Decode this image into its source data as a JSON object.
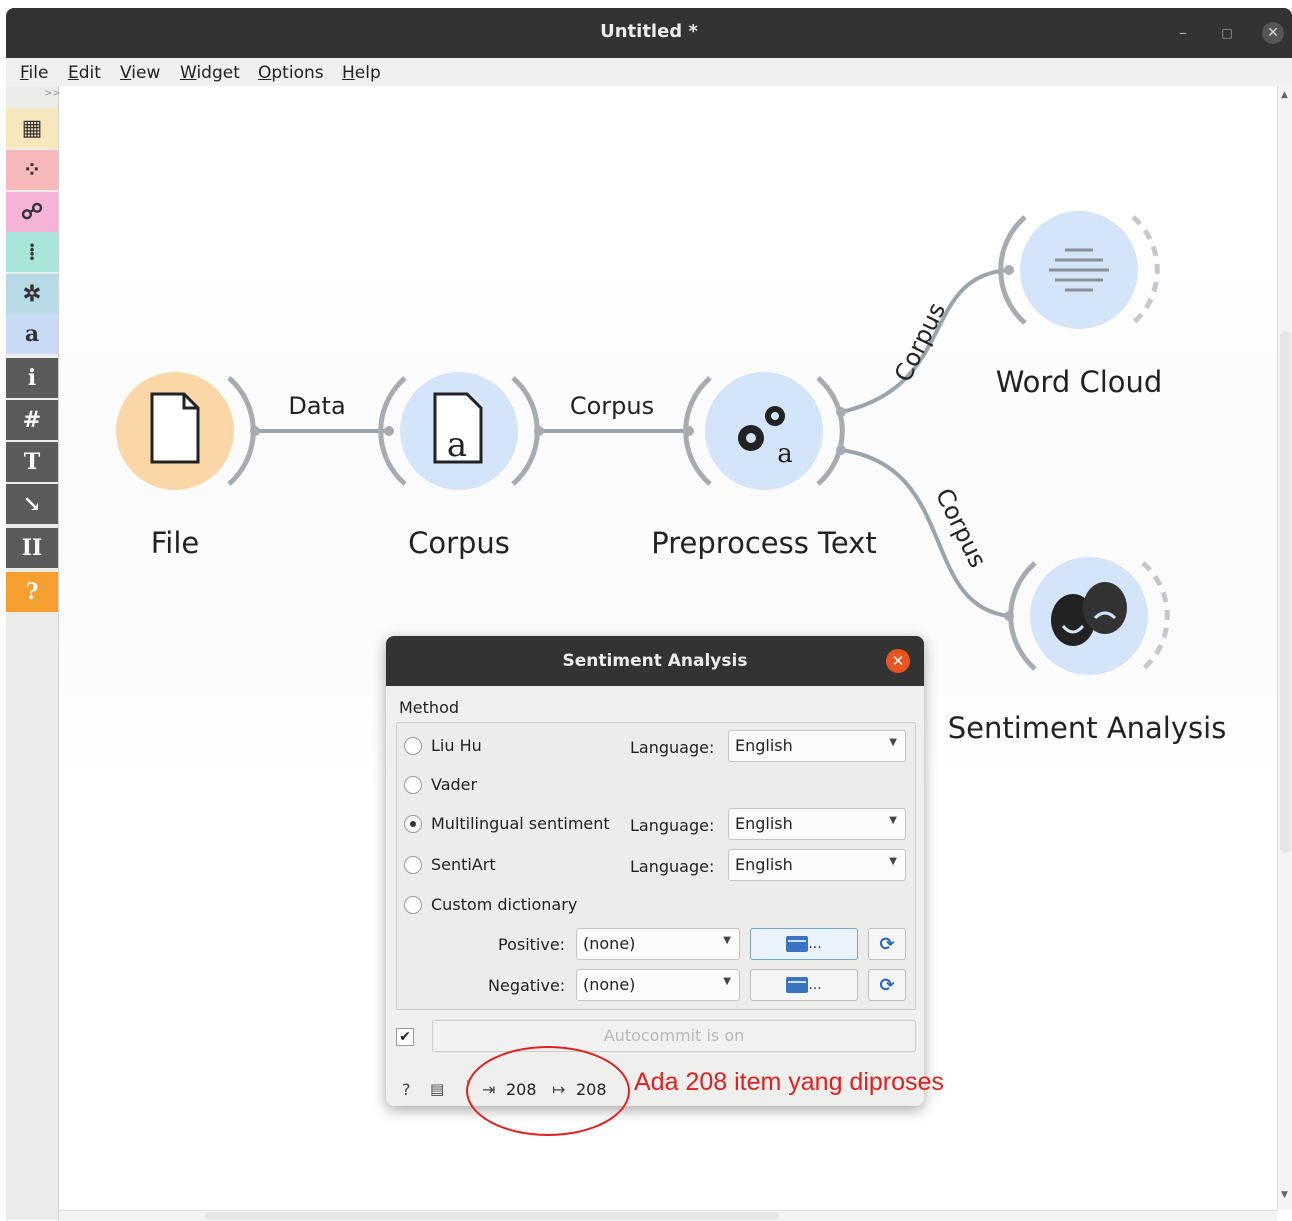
{
  "window": {
    "title": "Untitled *",
    "controls": {
      "minimize": "–",
      "maximize": "□",
      "close": "✕"
    }
  },
  "menu": [
    "File",
    "Edit",
    "View",
    "Widget",
    "Options",
    "Help"
  ],
  "toolbar": {
    "expander": ">>",
    "items": [
      {
        "name": "data-category",
        "icon": "table-icon",
        "glyph": "▦",
        "bg": "#f7e7bd"
      },
      {
        "name": "visualize-category",
        "icon": "scatter-icon",
        "glyph": "⁘",
        "bg": "#f7b9b9"
      },
      {
        "name": "model-category",
        "icon": "tree-icon",
        "glyph": "☍",
        "bg": "#f6b3d8"
      },
      {
        "name": "evaluate-category",
        "icon": "grid-icon",
        "glyph": "⁞",
        "bg": "#a8e6dc"
      },
      {
        "name": "unsupervised-category",
        "icon": "cluster-icon",
        "glyph": "✲",
        "bg": "#b8d9e6"
      },
      {
        "name": "text-mining-category",
        "icon": "text-a-icon",
        "glyph": "a",
        "bg": "#c9daf6"
      },
      {
        "name": "info-button",
        "icon": "info-icon",
        "glyph": "i",
        "bg": "#5a5a5a"
      },
      {
        "name": "grid-button",
        "icon": "hash-icon",
        "glyph": "#",
        "bg": "#5a5a5a"
      },
      {
        "name": "text-annotation-button",
        "icon": "text-t-icon",
        "glyph": "T",
        "bg": "#5a5a5a"
      },
      {
        "name": "arrow-annotation-button",
        "icon": "arrow-icon",
        "glyph": "↘",
        "bg": "#5a5a5a"
      },
      {
        "name": "pause-button",
        "icon": "pause-icon",
        "glyph": "II",
        "bg": "#5a5a5a"
      },
      {
        "name": "help-button",
        "icon": "help-icon",
        "glyph": "?",
        "bg": "#f5a030"
      }
    ]
  },
  "workflow": {
    "nodes": [
      {
        "name": "file",
        "label": "File",
        "icon": "file-icon",
        "color": "#fbd7a8",
        "ring": "#f7c58c"
      },
      {
        "name": "corpus",
        "label": "Corpus",
        "icon": "corpus-icon",
        "color": "#d4e4f9",
        "ring": "#bfd6f5"
      },
      {
        "name": "preprocess-text",
        "label": "Preprocess Text",
        "icon": "gears-icon",
        "color": "#d4e4f9",
        "ring": "#bfd6f5"
      },
      {
        "name": "word-cloud",
        "label": "Word Cloud",
        "icon": "word-cloud-icon",
        "color": "#d4e4f9",
        "ring": "#bfd6f5"
      },
      {
        "name": "sentiment-analysis",
        "label": "Sentiment Analysis",
        "icon": "masks-icon",
        "color": "#d4e4f9",
        "ring": "#bfd6f5"
      }
    ],
    "links": [
      {
        "from": "file",
        "to": "corpus",
        "label": "Data"
      },
      {
        "from": "corpus",
        "to": "preprocess-text",
        "label": "Corpus"
      },
      {
        "from": "preprocess-text",
        "to": "word-cloud",
        "label": "Corpus"
      },
      {
        "from": "preprocess-text",
        "to": "sentiment-analysis",
        "label": "Corpus"
      }
    ]
  },
  "dialog": {
    "title": "Sentiment Analysis",
    "method_group_label": "Method",
    "methods": [
      {
        "label": "Liu Hu",
        "selected": false,
        "has_language": true,
        "language": "English"
      },
      {
        "label": "Vader",
        "selected": false,
        "has_language": false
      },
      {
        "label": "Multilingual sentiment",
        "selected": true,
        "has_language": true,
        "language": "English"
      },
      {
        "label": "SentiArt",
        "selected": false,
        "has_language": true,
        "language": "English"
      },
      {
        "label": "Custom dictionary",
        "selected": false,
        "has_language": false
      }
    ],
    "language_label": "Language:",
    "positive": {
      "label": "Positive:",
      "value": "(none)",
      "browse": "...",
      "reload_icon": "reload-icon"
    },
    "negative": {
      "label": "Negative:",
      "value": "(none)",
      "browse": "...",
      "reload_icon": "reload-icon"
    },
    "autocommit": {
      "checked": true,
      "label": "Autocommit is on"
    },
    "status": {
      "help": "?",
      "input_count": "208",
      "output_count": "208"
    }
  },
  "annotation": {
    "text": "Ada 208 item yang diproses",
    "color": "#e02020"
  }
}
